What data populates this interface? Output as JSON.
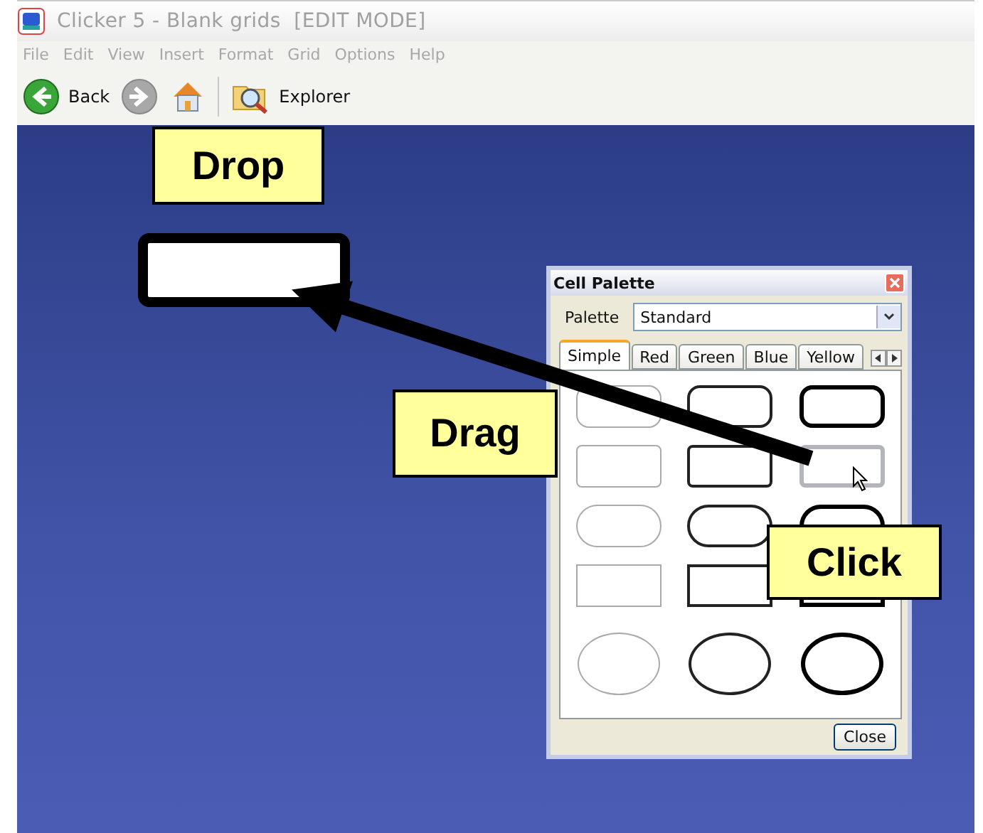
{
  "window": {
    "title": "Clicker 5 - Blank grids  [EDIT MODE]",
    "active": false
  },
  "menu": [
    "File",
    "Edit",
    "View",
    "Insert",
    "Format",
    "Grid",
    "Options",
    "Help"
  ],
  "toolbar": [
    {
      "kind": "back",
      "label": "Back"
    },
    {
      "kind": "forward"
    },
    {
      "kind": "home"
    },
    {
      "kind": "separator"
    },
    {
      "kind": "explorer",
      "label": "Explorer"
    }
  ],
  "callouts": [
    {
      "kind": "drop",
      "label": "Drop"
    },
    {
      "kind": "drag",
      "label": "Drag"
    },
    {
      "kind": "click",
      "label": "Click"
    }
  ],
  "palette_dialog": {
    "title": "Cell Palette",
    "palette_label": "Palette",
    "palette_value": "Standard",
    "tabs": [
      {
        "label": "Simple",
        "selected": true
      },
      {
        "label": "Red",
        "selected": false
      },
      {
        "label": "Green",
        "selected": false
      },
      {
        "label": "Blue",
        "selected": false
      },
      {
        "label": "Yellow",
        "selected": false
      }
    ],
    "cells": [
      {
        "kind": "rounded",
        "selected": false
      },
      {
        "kind": "rounded",
        "selected": false
      },
      {
        "kind": "rounded",
        "selected": false
      },
      {
        "kind": "soft",
        "selected": false
      },
      {
        "kind": "soft",
        "selected": false
      },
      {
        "kind": "soft",
        "selected": true
      },
      {
        "kind": "pill",
        "selected": false
      },
      {
        "kind": "pill",
        "selected": false
      },
      {
        "kind": "pill",
        "selected": false
      },
      {
        "kind": "square",
        "selected": false
      },
      {
        "kind": "square",
        "selected": false
      },
      {
        "kind": "square",
        "selected": false
      },
      {
        "kind": "circle",
        "selected": false
      },
      {
        "kind": "circle",
        "selected": false
      },
      {
        "kind": "circle",
        "selected": false
      }
    ],
    "close_button": "Close"
  }
}
